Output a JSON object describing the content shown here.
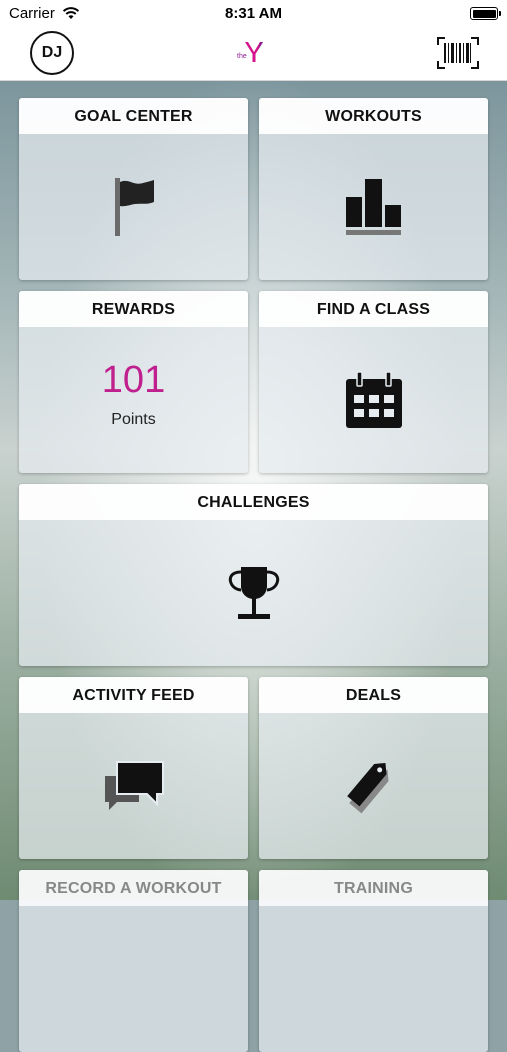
{
  "status_bar": {
    "carrier": "Carrier",
    "time": "8:31 AM"
  },
  "header": {
    "avatar_initials": "DJ",
    "logo_text": "the",
    "logo_icon": "ymca-logo",
    "barcode_icon": "barcode-icon"
  },
  "tiles": {
    "goal_center": {
      "title": "GOAL CENTER",
      "icon": "flag-icon"
    },
    "workouts": {
      "title": "WORKOUTS",
      "icon": "bar-chart-icon"
    },
    "rewards": {
      "title": "REWARDS",
      "points_value": "101",
      "points_label": "Points"
    },
    "find_class": {
      "title": "FIND A CLASS",
      "icon": "calendar-icon"
    },
    "challenges": {
      "title": "CHALLENGES",
      "icon": "trophy-icon"
    },
    "activity_feed": {
      "title": "ACTIVITY FEED",
      "icon": "chat-bubbles-icon"
    },
    "deals": {
      "title": "DEALS",
      "icon": "tags-icon"
    },
    "record_workout": {
      "title": "RECORD A WORKOUT"
    },
    "training": {
      "title": "TRAINING"
    }
  },
  "colors": {
    "points_accent": "#c0208e",
    "logo_purple": "#8b1c8f",
    "logo_magenta": "#d4148c"
  }
}
